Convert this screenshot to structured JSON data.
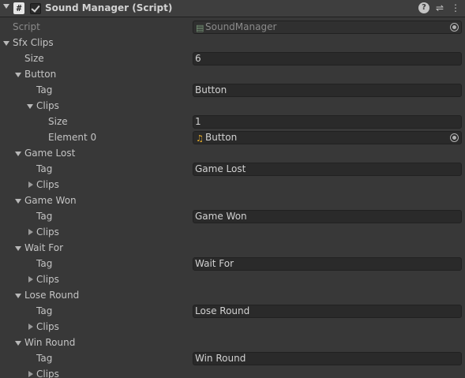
{
  "header": {
    "title": "Sound Manager (Script)",
    "script_icon": "#",
    "help_icon": "?",
    "settings_icon": "⇌",
    "menu_icon": "⋮"
  },
  "script_row": {
    "label": "Script",
    "value": "SoundManager"
  },
  "sfx": {
    "label": "Sfx Clips",
    "size_label": "Size",
    "size_value": "6",
    "entries": [
      {
        "name": "Button",
        "tag_label": "Tag",
        "tag_value": "Button",
        "clips_label": "Clips",
        "clips_size_label": "Size",
        "clips_size_value": "1",
        "element_label": "Element 0",
        "element_value": "Button"
      },
      {
        "name": "Game Lost",
        "tag_label": "Tag",
        "tag_value": "Game Lost",
        "clips_label": "Clips"
      },
      {
        "name": "Game Won",
        "tag_label": "Tag",
        "tag_value": "Game Won",
        "clips_label": "Clips"
      },
      {
        "name": "Wait For",
        "tag_label": "Tag",
        "tag_value": "Wait For",
        "clips_label": "Clips"
      },
      {
        "name": "Lose Round",
        "tag_label": "Tag",
        "tag_value": "Lose Round",
        "clips_label": "Clips"
      },
      {
        "name": "Win Round",
        "tag_label": "Tag",
        "tag_value": "Win Round",
        "clips_label": "Clips"
      }
    ]
  },
  "colors": {
    "background": "#383838",
    "field_background": "#2a2a2a",
    "audio_icon": "#f0b429"
  }
}
